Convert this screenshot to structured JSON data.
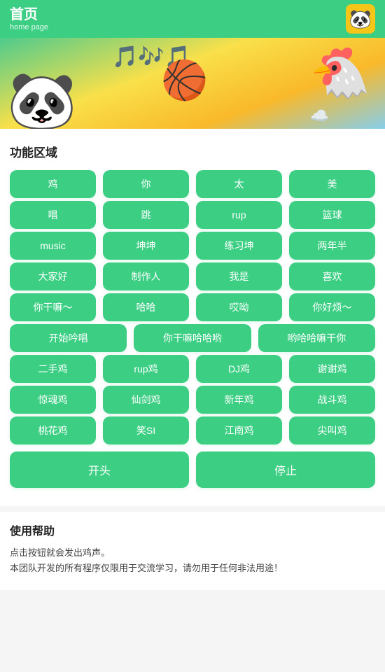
{
  "header": {
    "title": "首页",
    "subtitle": "home page",
    "avatar_emoji": "🐼"
  },
  "banner": {
    "panda_emoji": "🐼",
    "basketball_emoji": "🏀",
    "chicken_emoji": "🐔",
    "notes_emoji": "🎵🎶🎵",
    "cloud_emoji": "☁️"
  },
  "function_section": {
    "title": "功能区域",
    "rows": [
      [
        "鸡",
        "你",
        "太",
        "美"
      ],
      [
        "唱",
        "跳",
        "rup",
        "篮球"
      ],
      [
        "music",
        "坤坤",
        "练习坤",
        "两年半"
      ],
      [
        "大家好",
        "制作人",
        "我是",
        "喜欢"
      ],
      [
        "你干嘛～",
        "哈哈",
        "哎呦",
        "你好烦～"
      ],
      [
        "开始吟唱",
        "你干嘛哈哈哟",
        "哟哈哈嘛干你"
      ],
      [
        "二手鸡",
        "rup鸡",
        "DJ鸡",
        "谢谢鸡"
      ],
      [
        "惊魂鸡",
        "仙剑鸡",
        "新年鸡",
        "战斗鸡"
      ],
      [
        "桃花鸡",
        "笑SI",
        "江南鸡",
        "尖叫鸡"
      ]
    ],
    "row5_wide": true,
    "action_start": "开头",
    "action_stop": "停止"
  },
  "help_section": {
    "title": "使用帮助",
    "line1": "点击按钮就会发出鸡声。",
    "line2": "本团队开发的所有程序仅限用于交流学习，请勿用于任何非法用途！"
  }
}
